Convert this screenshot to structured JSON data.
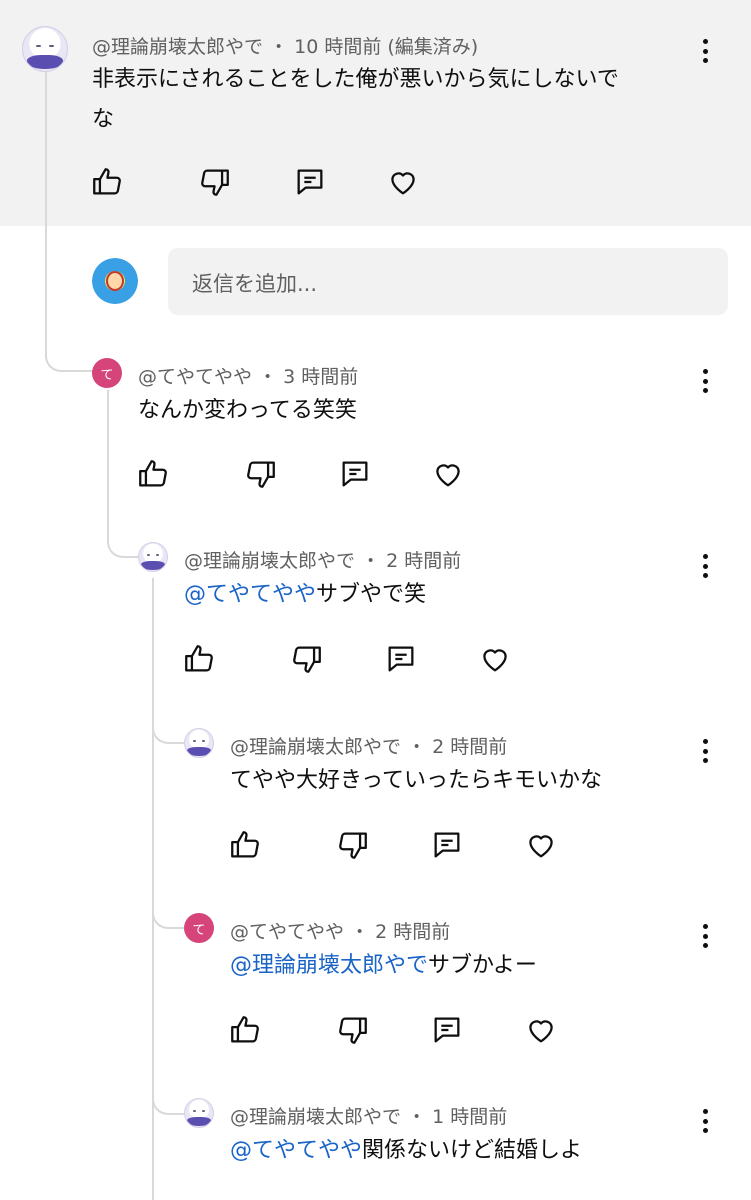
{
  "top_comment": {
    "author": "@理論崩壊太郎やで",
    "time": "10 時間前",
    "edited": "(編集済み)",
    "text_line1": "非表示にされることをした俺が悪いから気にしないで",
    "text_line2": "な"
  },
  "reply_input": {
    "placeholder": "返信を追加..."
  },
  "replies": [
    {
      "author": "@てやてやや",
      "time": "3 時間前",
      "avatar_letter": "て",
      "mention": "",
      "text": "なんか変わってる笑笑"
    },
    {
      "author": "@理論崩壊太郎やで",
      "time": "2 時間前",
      "mention": "@てやてやや",
      "text": "サブやで笑"
    },
    {
      "author": "@理論崩壊太郎やで",
      "time": "2 時間前",
      "mention": "",
      "text": "てやや大好きっていったらキモいかな"
    },
    {
      "author": "@てやてやや",
      "time": "2 時間前",
      "avatar_letter": "て",
      "mention": "@理論崩壊太郎やで",
      "text": "サブかよー"
    },
    {
      "author": "@理論崩壊太郎やで",
      "time": "1 時間前",
      "mention": "@てやてやや",
      "text": "関係ないけど結婚しよ"
    }
  ],
  "separator": "・",
  "icons": [
    "like-icon",
    "dislike-icon",
    "reply-icon",
    "heart-icon",
    "more-vert-icon"
  ],
  "colors": {
    "mention": "#1a64c8",
    "avatar_te": "#d6457a",
    "highlight_bg": "#f2f2f2",
    "meta_text": "#606060"
  }
}
